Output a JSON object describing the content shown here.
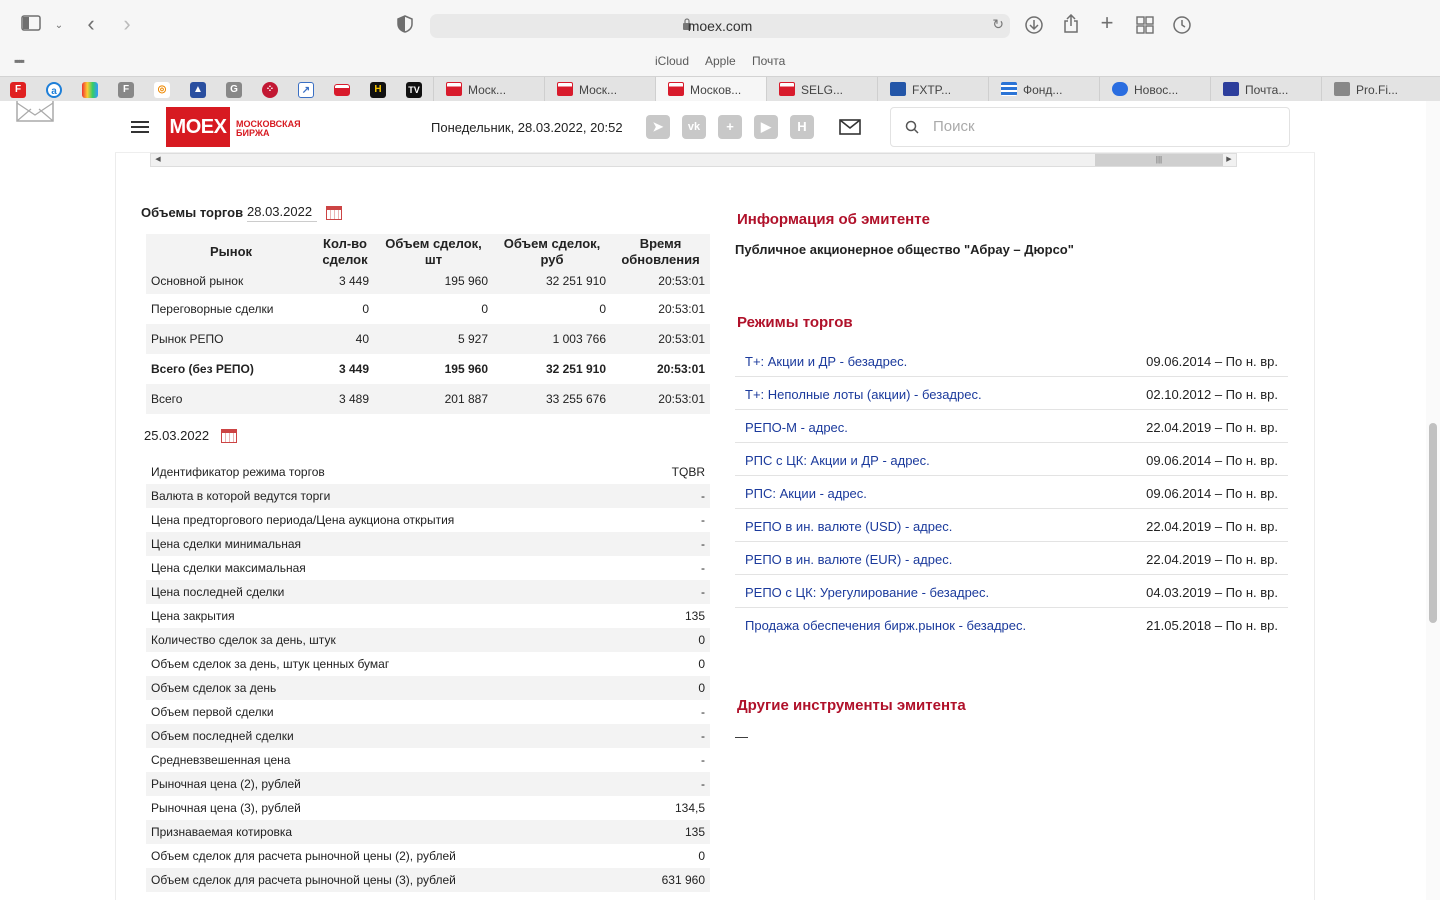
{
  "browser": {
    "url": "moex.com",
    "favorites": [
      "iCloud",
      "Apple",
      "Почта"
    ],
    "tabs": [
      {
        "label": "Моск...",
        "active": false
      },
      {
        "label": "Моск...",
        "active": false
      },
      {
        "label": "Москов...",
        "active": true
      },
      {
        "label": "SELG...",
        "active": false
      },
      {
        "label": "FXTP...",
        "active": false
      },
      {
        "label": "Фонд...",
        "active": false
      },
      {
        "label": "Новос...",
        "active": false
      },
      {
        "label": "Почта...",
        "active": false
      },
      {
        "label": "Pro.Fi...",
        "active": false
      }
    ]
  },
  "header": {
    "logo_text": "MOEX",
    "logo_sub1": "Московская",
    "logo_sub2": "биржа",
    "date": "Понедельник, 28.03.2022, 20:52",
    "search_placeholder": "Поиск",
    "brand_color": "#d71a21"
  },
  "volumes": {
    "title": "Объемы торгов",
    "date": "28.03.2022",
    "headers": [
      "Рынок",
      "Кол-во сделок",
      "Объем сделок, шт",
      "Объем сделок, руб",
      "Время обновления"
    ],
    "rows": [
      [
        "Основной рынок",
        "3 449",
        "195 960",
        "32 251 910",
        "20:53:01"
      ],
      [
        "Переговорные сделки",
        "0",
        "0",
        "0",
        "20:53:01"
      ],
      [
        "Рынок РЕПО",
        "40",
        "5 927",
        "1 003 766",
        "20:53:01"
      ],
      [
        "Всего (без РЕПО)",
        "3 449",
        "195 960",
        "32 251 910",
        "20:53:01"
      ],
      [
        "Всего",
        "3 489",
        "201 887",
        "33 255 676",
        "20:53:01"
      ]
    ]
  },
  "params": {
    "date": "25.03.2022",
    "rows": [
      [
        "Идентификатор режима торгов",
        "TQBR"
      ],
      [
        "Валюта в которой ведутся торги",
        "-"
      ],
      [
        "Цена предторгового периода/Цена аукциона открытия",
        "-"
      ],
      [
        "Цена сделки минимальная",
        "-"
      ],
      [
        "Цена сделки максимальная",
        "-"
      ],
      [
        "Цена последней сделки",
        "-"
      ],
      [
        "Цена закрытия",
        "135"
      ],
      [
        "Количество сделок за день, штук",
        "0"
      ],
      [
        "Объем сделок за день, штук ценных бумаг",
        "0"
      ],
      [
        "Объем сделок за день",
        "0"
      ],
      [
        "Объем первой сделки",
        "-"
      ],
      [
        "Объем последней сделки",
        "-"
      ],
      [
        "Средневзвешенная цена",
        "-"
      ],
      [
        "Рыночная цена (2), рублей",
        "-"
      ],
      [
        "Рыночная цена (3), рублей",
        "134,5"
      ],
      [
        "Признаваемая котировка",
        "135"
      ],
      [
        "Объем сделок для расчета рыночной цены (2), рублей",
        "0"
      ],
      [
        "Объем сделок для расчета рыночной цены (3), рублей",
        "631 960"
      ]
    ]
  },
  "issuer": {
    "title": "Информация об эмитенте",
    "name": "Публичное акционерное общество \"Абрау – Дюрсо\""
  },
  "modes": {
    "title": "Режимы торгов",
    "rows": [
      [
        "Т+: Акции и ДР - безадрес.",
        "09.06.2014 – По н. вр."
      ],
      [
        "Т+: Неполные лоты (акции) - безадрес.",
        "02.10.2012 – По н. вр."
      ],
      [
        "РЕПО-М - адрес.",
        "22.04.2019 – По н. вр."
      ],
      [
        "РПС с ЦК: Акции и ДР - адрес.",
        "09.06.2014 – По н. вр."
      ],
      [
        "РПС: Акции - адрес.",
        "09.06.2014 – По н. вр."
      ],
      [
        "РЕПО в ин. валюте (USD) - адрес.",
        "22.04.2019 – По н. вр."
      ],
      [
        "РЕПО в ин. валюте (EUR) - адрес.",
        "22.04.2019 – По н. вр."
      ],
      [
        "РЕПО с ЦК: Урегулирование - безадрес.",
        "04.03.2019 – По н. вр."
      ],
      [
        "Продажа обеспечения бирж.рынок - безадрес.",
        "21.05.2018 – По н. вр."
      ]
    ]
  },
  "other": {
    "title": "Другие инструменты эмитента",
    "value": "—"
  }
}
